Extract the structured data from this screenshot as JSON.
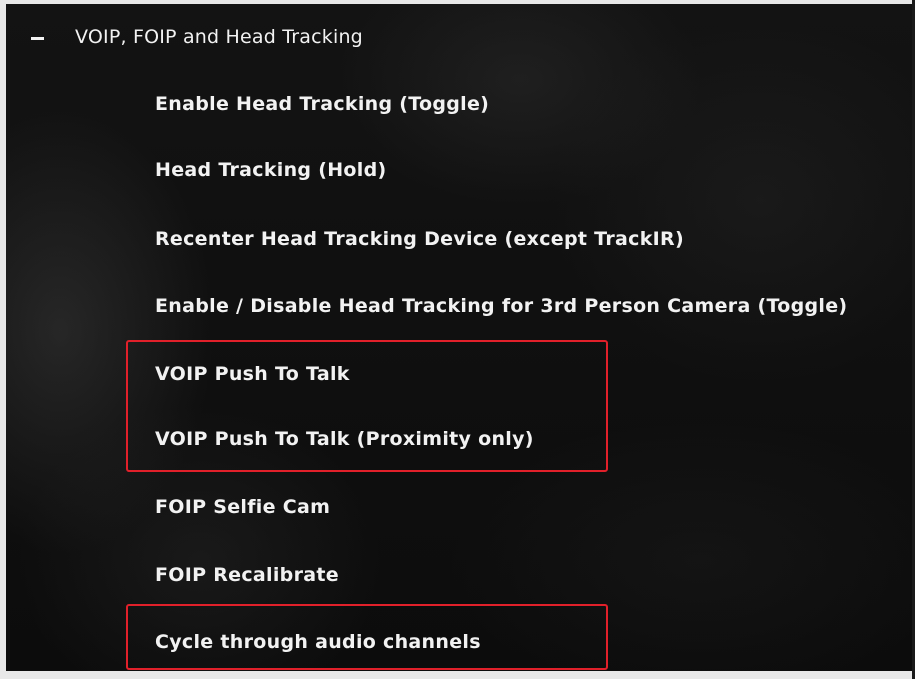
{
  "section": {
    "title": "VOIP, FOIP and Head Tracking",
    "collapse_icon": "minus-icon"
  },
  "items": [
    {
      "label": "Enable Head Tracking (Toggle)"
    },
    {
      "label": "Head Tracking (Hold)"
    },
    {
      "label": "Recenter Head Tracking Device (except TrackIR)"
    },
    {
      "label": "Enable / Disable Head Tracking for 3rd Person Camera (Toggle)"
    },
    {
      "label": "VOIP Push To Talk"
    },
    {
      "label": "VOIP Push To Talk (Proximity only)"
    },
    {
      "label": "FOIP Selfie Cam"
    },
    {
      "label": "FOIP Recalibrate"
    },
    {
      "label": "Cycle through audio channels"
    }
  ],
  "colors": {
    "text": "#f2f2f2",
    "highlight": "#e1202a",
    "background": "#101010"
  }
}
